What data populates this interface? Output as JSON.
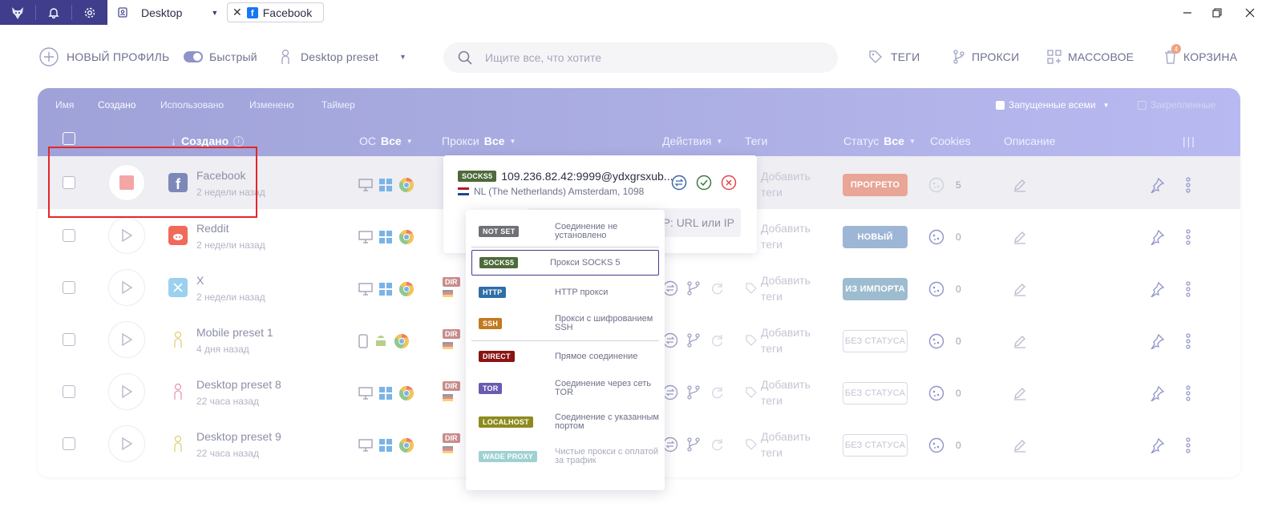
{
  "titlebar": {
    "tab_desktop": "Desktop",
    "tab_facebook": "Facebook"
  },
  "toolbar": {
    "new_profile": "НОВЫЙ ПРОФИЛЬ",
    "fast": "Быстрый",
    "preset": "Desktop preset",
    "search_placeholder": "Ищите все, что хотите",
    "tags": "ТЕГИ",
    "proxies": "ПРОКСИ",
    "bulk": "МАССОВОЕ",
    "trash": "КОРЗИНА",
    "trash_badge": "4"
  },
  "filters": {
    "tabs": [
      "Имя",
      "Создано",
      "Использовано",
      "Изменено",
      "Таймер"
    ],
    "running": "Запущенные всеми",
    "pinned": "Закрепленные"
  },
  "columns": {
    "created": "Создано",
    "os": "ОС",
    "os_all": "Все",
    "proxy": "Прокси",
    "proxy_all": "Все",
    "actions": "Действия",
    "tags": "Теги",
    "status": "Статус",
    "status_all": "Все",
    "cookies": "Cookies",
    "description": "Описание"
  },
  "rows": [
    {
      "name": "Facebook",
      "sub": "2 недели назад",
      "status": "ПРОГРЕТО",
      "status_color": "#e9a595",
      "cookies": "5",
      "tags": "Добавить теги"
    },
    {
      "name": "Reddit",
      "sub": "2 недели назад",
      "status": "НОВЫЙ",
      "status_color": "#9eb6d6",
      "cookies": "0",
      "tags": "Добавить теги"
    },
    {
      "name": "X",
      "sub": "2 недели назад",
      "status": "ИЗ ИМПОРТА",
      "status_color": "#9ebcd0",
      "cookies": "0",
      "tags": "Добавить теги"
    },
    {
      "name": "Mobile preset 1",
      "sub": "4 дня назад",
      "status": "БЕЗ СТАТУСА",
      "cookies": "0",
      "tags": "Добавить теги"
    },
    {
      "name": "Desktop preset 8",
      "sub": "22 часа назад",
      "status": "БЕЗ СТАТУСА",
      "cookies": "0",
      "tags": "Добавить теги"
    },
    {
      "name": "Desktop preset 9",
      "sub": "22 часа назад",
      "status": "БЕЗ СТАТУСА",
      "cookies": "0",
      "tags": "Добавить теги"
    }
  ],
  "proxy_popup": {
    "type": "SOCKS5",
    "address": "109.236.82.42:9999@ydxgrsxub...",
    "location": "NL (The Netherlands) Amsterdam, 1098",
    "input_placeholder": "я IP: URL или IP"
  },
  "proxy_row_tag": "DIR",
  "proxy_types": [
    {
      "tag": "NOT SET",
      "desc": "Соединение не установлено",
      "color": "#6f7075"
    },
    {
      "tag": "SOCKS5",
      "desc": "Прокси SOCKS 5",
      "color": "#4d6b3a"
    },
    {
      "tag": "HTTP",
      "desc": "HTTP прокси",
      "color": "#2f6ea6"
    },
    {
      "tag": "SSH",
      "desc": "Прокси с шифрованием SSH",
      "color": "#c27a1f"
    },
    {
      "tag": "DIRECT",
      "desc": "Прямое соединение",
      "color": "#8a1414"
    },
    {
      "tag": "TOR",
      "desc": "Соединение через сеть TOR",
      "color": "#6b5ab3"
    },
    {
      "tag": "LOCALHOST",
      "desc": "Соединение с указанным портом",
      "color": "#8d8b1d"
    },
    {
      "tag": "WADE PROXY",
      "desc": "Чистые прокси с оплатой за трафик",
      "color": "#9fd1d2"
    }
  ]
}
